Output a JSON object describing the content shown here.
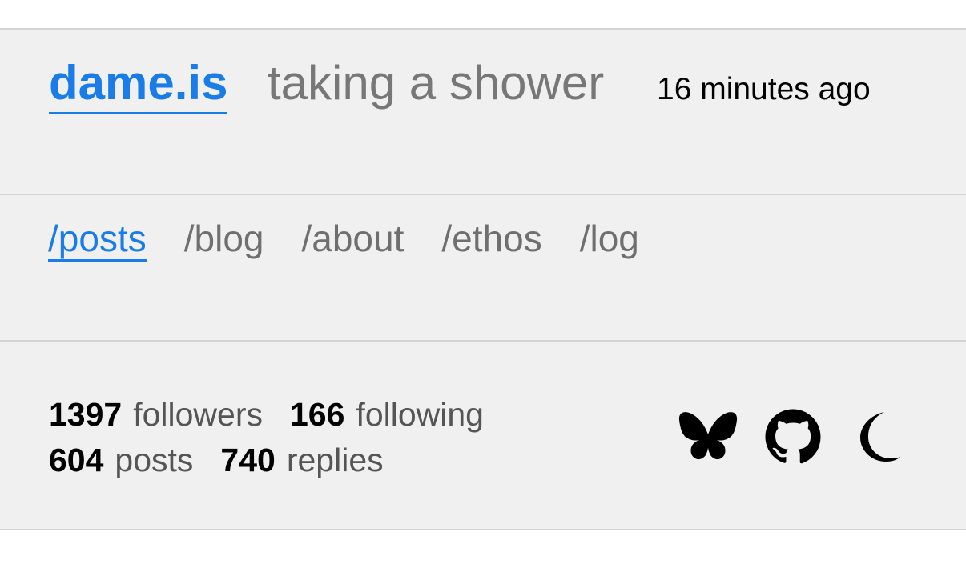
{
  "header": {
    "site_name": "dame.is",
    "status": "taking a shower",
    "status_time": "16 minutes ago"
  },
  "nav": {
    "items": [
      {
        "label": "/posts",
        "active": true
      },
      {
        "label": "/blog",
        "active": false
      },
      {
        "label": "/about",
        "active": false
      },
      {
        "label": "/ethos",
        "active": false
      },
      {
        "label": "/log",
        "active": false
      }
    ]
  },
  "stats": {
    "followers_count": "1397",
    "followers_label": "followers",
    "following_count": "166",
    "following_label": "following",
    "posts_count": "604",
    "posts_label": "posts",
    "replies_count": "740",
    "replies_label": "replies"
  },
  "icons": {
    "items": [
      "butterfly-icon",
      "github-icon",
      "moon-icon"
    ]
  },
  "colors": {
    "accent": "#1a7ce8",
    "panel_bg": "#f0f0f0",
    "muted_text": "#777777"
  }
}
